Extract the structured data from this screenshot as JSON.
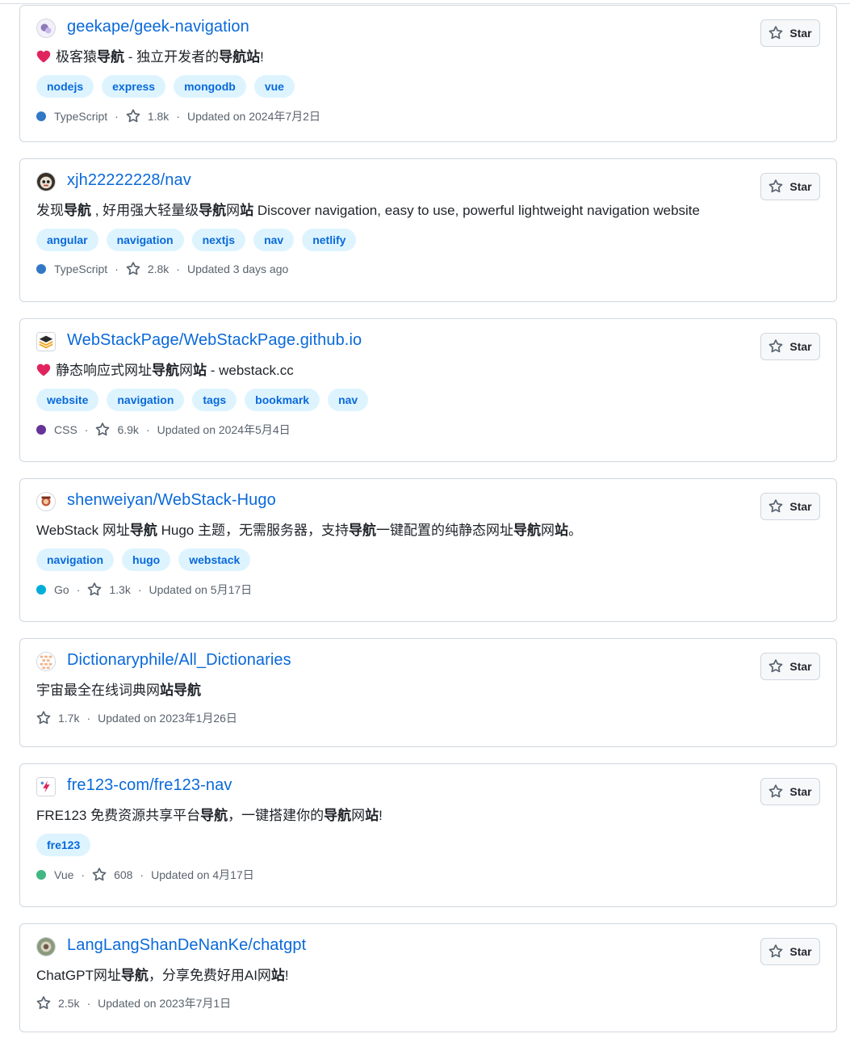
{
  "repos": [
    {
      "name": "geekape/geek-navigation",
      "desc_parts": [
        {
          "t": "极客猿",
          "b": false
        },
        {
          "t": "导航",
          "b": true
        },
        {
          "t": " - 独立开发者的",
          "b": false
        },
        {
          "t": "导航站",
          "b": true
        },
        {
          "t": "!",
          "b": false
        }
      ],
      "has_heart": true,
      "topics": [
        "nodejs",
        "express",
        "mongodb",
        "vue"
      ],
      "language": "TypeScript",
      "language_color": "#3178c6",
      "stars": "1.8k",
      "updated": "Updated on 2024年7月2日",
      "star_label": "Star",
      "avatar": "avatar-geekape"
    },
    {
      "name": "xjh22222228/nav",
      "desc_parts": [
        {
          "t": "发现",
          "b": false
        },
        {
          "t": "导航",
          "b": true
        },
        {
          "t": " , 好用强大轻量级",
          "b": false
        },
        {
          "t": "导航",
          "b": true
        },
        {
          "t": "网",
          "b": false
        },
        {
          "t": "站",
          "b": true
        },
        {
          "t": " Discover navigation, easy to use, powerful lightweight navigation website",
          "b": false
        }
      ],
      "has_heart": false,
      "topics": [
        "angular",
        "navigation",
        "nextjs",
        "nav",
        "netlify"
      ],
      "language": "TypeScript",
      "language_color": "#3178c6",
      "stars": "2.8k",
      "updated": "Updated 3 days ago",
      "star_label": "Star",
      "avatar": "avatar-xjh"
    },
    {
      "name": "WebStackPage/WebStackPage.github.io",
      "desc_parts": [
        {
          "t": "静态响应式网址",
          "b": false
        },
        {
          "t": "导航",
          "b": true
        },
        {
          "t": "网",
          "b": false
        },
        {
          "t": "站",
          "b": true
        },
        {
          "t": " - webstack.cc",
          "b": false
        }
      ],
      "has_heart": true,
      "topics": [
        "website",
        "navigation",
        "tags",
        "bookmark",
        "nav"
      ],
      "language": "CSS",
      "language_color": "#663399",
      "stars": "6.9k",
      "updated": "Updated on 2024年5月4日",
      "star_label": "Star",
      "avatar": "avatar-webstack"
    },
    {
      "name": "shenweiyan/WebStack-Hugo",
      "desc_parts": [
        {
          "t": "WebStack 网址",
          "b": false
        },
        {
          "t": "导航",
          "b": true
        },
        {
          "t": " Hugo 主题，无需服务器，支持",
          "b": false
        },
        {
          "t": "导航",
          "b": true
        },
        {
          "t": "一键配置的纯静态网址",
          "b": false
        },
        {
          "t": "导航",
          "b": true
        },
        {
          "t": "网",
          "b": false
        },
        {
          "t": "站",
          "b": true
        },
        {
          "t": "。",
          "b": false
        }
      ],
      "has_heart": false,
      "topics": [
        "navigation",
        "hugo",
        "webstack"
      ],
      "language": "Go",
      "language_color": "#00add8",
      "stars": "1.3k",
      "updated": "Updated on 5月17日",
      "star_label": "Star",
      "avatar": "avatar-shenweiyan"
    },
    {
      "name": "Dictionaryphile/All_Dictionaries",
      "desc_parts": [
        {
          "t": "宇宙最全在线词典网",
          "b": false
        },
        {
          "t": "站导航",
          "b": true
        }
      ],
      "has_heart": false,
      "topics": [],
      "language": "",
      "language_color": "",
      "stars": "1.7k",
      "updated": "Updated on 2023年1月26日",
      "star_label": "Star",
      "avatar": "avatar-dictionaryphile"
    },
    {
      "name": "fre123-com/fre123-nav",
      "desc_parts": [
        {
          "t": "FRE123 免费资源共享平台",
          "b": false
        },
        {
          "t": "导航",
          "b": true
        },
        {
          "t": "，一键搭建你的",
          "b": false
        },
        {
          "t": "导航",
          "b": true
        },
        {
          "t": "网",
          "b": false
        },
        {
          "t": "站",
          "b": true
        },
        {
          "t": "!",
          "b": false
        }
      ],
      "has_heart": false,
      "topics": [
        "fre123"
      ],
      "language": "Vue",
      "language_color": "#41b883",
      "stars": "608",
      "updated": "Updated on 4月17日",
      "star_label": "Star",
      "avatar": "avatar-fre123"
    },
    {
      "name": "LangLangShanDeNanKe/chatgpt",
      "desc_parts": [
        {
          "t": "ChatGPT网址",
          "b": false
        },
        {
          "t": "导航",
          "b": true
        },
        {
          "t": "，分享免费好用AI网",
          "b": false
        },
        {
          "t": "站",
          "b": true
        },
        {
          "t": "!",
          "b": false
        }
      ],
      "has_heart": false,
      "topics": [],
      "language": "",
      "language_color": "",
      "stars": "2.5k",
      "updated": "Updated on 2023年7月1日",
      "star_label": "Star",
      "avatar": "avatar-langlang"
    }
  ]
}
